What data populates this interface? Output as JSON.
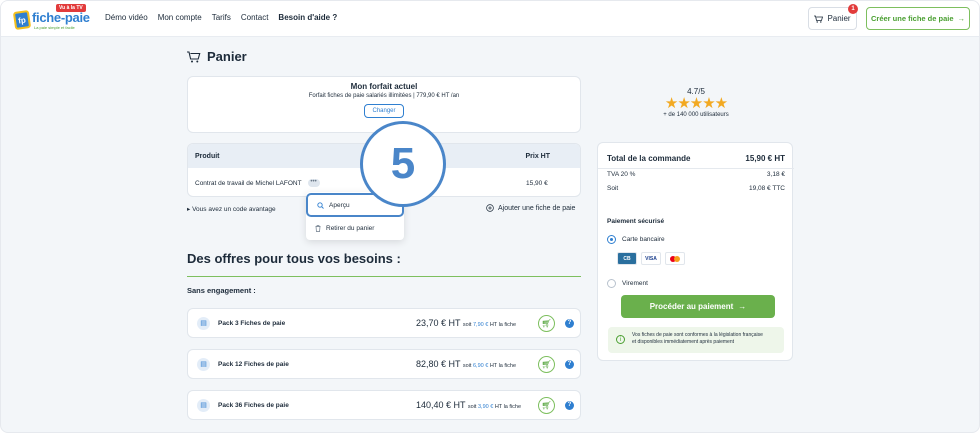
{
  "header": {
    "logo_name": "fiche-paie",
    "logo_badge": "Vu à la TV",
    "logo_tagline": "La paie simple et facile",
    "nav": [
      "Démo vidéo",
      "Mon compte",
      "Tarifs",
      "Contact",
      "Besoin d'aide ?"
    ],
    "cart_label": "Panier",
    "cart_count": "1",
    "create_label": "Créer une fiche de paie"
  },
  "page_title": "Panier",
  "forfait": {
    "title": "Mon forfait actuel",
    "detail": "Forfait fiches de paie salariés illimitées | 779,90 € HT /an",
    "change_label": "Changer"
  },
  "cart_table": {
    "headers": {
      "product": "Produit",
      "price": "Prix HT"
    },
    "row": {
      "name": "Contrat de travail de Michel LAFONT",
      "more": "•••",
      "price": "15,90 €"
    }
  },
  "popover": {
    "preview": "Aperçu",
    "remove": "Retirer du panier"
  },
  "step_number": "5",
  "code_link": "Vous avez un code avantage",
  "add_link": "Ajouter une fiche de paie",
  "offers": {
    "title": "Des offres pour tous vos besoins :",
    "subtitle": "Sans engagement :",
    "items": [
      {
        "label": "Pack 3 Fiches de paie",
        "price": "23,70 € HT",
        "soit": "soit",
        "unit": "7,90 €",
        "ht": "HT",
        "suffix": "la fiche"
      },
      {
        "label": "Pack 12 Fiches de paie",
        "price": "82,80 € HT",
        "soit": "soit",
        "unit": "6,90 €",
        "ht": "HT",
        "suffix": "la fiche"
      },
      {
        "label": "Pack 36 Fiches de paie",
        "price": "140,40 € HT",
        "soit": "soit",
        "unit": "3,90 €",
        "ht": "HT",
        "suffix": "la fiche"
      }
    ]
  },
  "rating": {
    "score": "4.7/5",
    "stars": "★★★★★",
    "users": "+ de 140 000 utilisateurs"
  },
  "summary": {
    "total_label": "Total de la commande",
    "total_value": "15,90 € HT",
    "tva_label": "TVA 20 %",
    "tva_value": "3,18 €",
    "soit_label": "Soit",
    "soit_value": "19,08 € TTC",
    "secure_label": "Paiement sécurisé",
    "card_label": "Carte bancaire",
    "cb": "CB",
    "visa": "VISA",
    "transfer_label": "Virement",
    "pay_label": "Procéder au paiement",
    "legal_line1": "Vos fiches de paie sont conformes à la législation française",
    "legal_line2": "et disponibles immédiatement après paiement"
  },
  "colors": {
    "brand_blue": "#2f7fd0",
    "brand_green": "#6ab04c",
    "highlight": "#4a86c9"
  }
}
